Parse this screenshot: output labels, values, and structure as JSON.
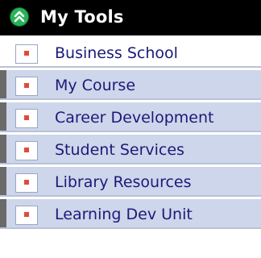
{
  "header": {
    "title": "My Tools",
    "icon": "collapse-chevron-up-icon",
    "icon_color": "#28b35a"
  },
  "menu": {
    "items": [
      {
        "label": "Business School",
        "active": true
      },
      {
        "label": "My Course",
        "active": false
      },
      {
        "label": "Career Development",
        "active": false
      },
      {
        "label": "Student Services",
        "active": false
      },
      {
        "label": "Library Resources",
        "active": false
      },
      {
        "label": "Learning Dev Unit",
        "active": false
      }
    ]
  },
  "colors": {
    "header_bg": "#000000",
    "item_bg": "#cdd6ea",
    "active_item_bg": "#ffffff",
    "link_text": "#1a1a7a",
    "bullet": "#e24a3a"
  }
}
